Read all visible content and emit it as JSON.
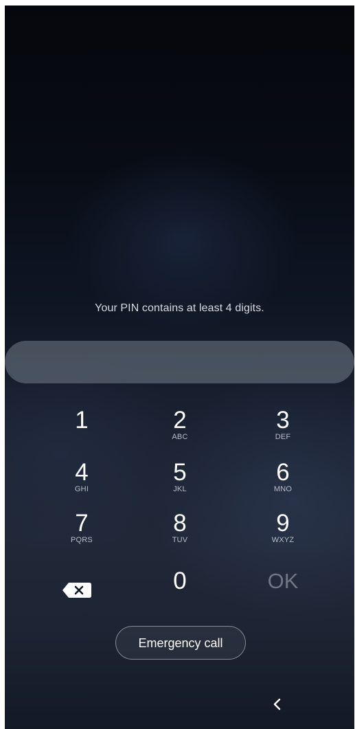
{
  "screen": {
    "hint_text": "Your PIN contains at least 4 digits.",
    "pin_value": ""
  },
  "keypad": {
    "keys": [
      {
        "digit": "1",
        "letters": ""
      },
      {
        "digit": "2",
        "letters": "ABC"
      },
      {
        "digit": "3",
        "letters": "DEF"
      },
      {
        "digit": "4",
        "letters": "GHI"
      },
      {
        "digit": "5",
        "letters": "JKL"
      },
      {
        "digit": "6",
        "letters": "MNO"
      },
      {
        "digit": "7",
        "letters": "PQRS"
      },
      {
        "digit": "8",
        "letters": "TUV"
      },
      {
        "digit": "9",
        "letters": "WXYZ"
      }
    ],
    "zero": "0",
    "ok": "OK"
  },
  "actions": {
    "emergency_call": "Emergency call"
  },
  "icons": {
    "backspace": "backspace-icon",
    "back": "back-icon"
  },
  "colors": {
    "text": "#ffffff",
    "muted_text": "#b8bec8",
    "ok_disabled": "#707784",
    "pin_field": "#697280"
  }
}
